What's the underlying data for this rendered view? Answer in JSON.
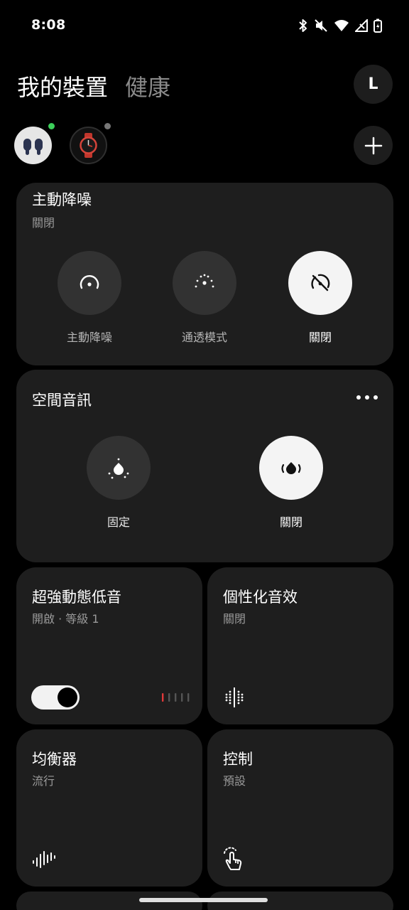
{
  "status": {
    "time": "8:08"
  },
  "header": {
    "tab_my_devices": "我的裝置",
    "tab_health": "健康",
    "avatar_initial": "L"
  },
  "noise_control": {
    "title": "主動降噪",
    "subtitle": "關閉",
    "modes": [
      {
        "label": "主動降噪",
        "active": false
      },
      {
        "label": "通透模式",
        "active": false
      },
      {
        "label": "關閉",
        "active": true
      }
    ]
  },
  "spatial_audio": {
    "title": "空間音訊",
    "modes": [
      {
        "label": "固定",
        "active": false
      },
      {
        "label": "關閉",
        "active": true
      }
    ]
  },
  "bass": {
    "title": "超強動態低音",
    "subtitle": "開啟 · 等級 1",
    "enabled": true,
    "level": 1,
    "level_max": 5
  },
  "personal_sound": {
    "title": "個性化音效",
    "subtitle": "關閉"
  },
  "equalizer": {
    "title": "均衡器",
    "subtitle": "流行"
  },
  "controls": {
    "title": "控制",
    "subtitle": "預設"
  },
  "colors": {
    "accent_green": "#3ccf5a",
    "bass_level_red": "#e0393a",
    "card_bg": "#1e1e1e"
  }
}
